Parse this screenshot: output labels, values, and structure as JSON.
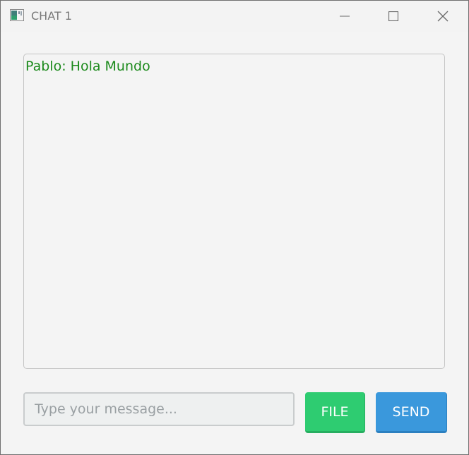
{
  "window": {
    "title": "CHAT 1",
    "controls": {
      "minimize": "minimize-icon",
      "maximize": "maximize-icon",
      "close": "close-icon"
    }
  },
  "chat": {
    "messages": [
      {
        "text": "Pablo: Hola Mundo",
        "color": "#1c8a1c"
      }
    ]
  },
  "composer": {
    "input_value": "",
    "input_placeholder": "Type your message...",
    "file_label": "FILE",
    "send_label": "SEND"
  },
  "colors": {
    "file_button": "#2ecc71",
    "send_button": "#3a98dc",
    "message_text": "#1c8a1c"
  }
}
